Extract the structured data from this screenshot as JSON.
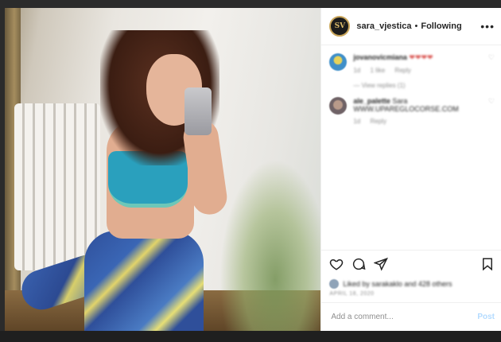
{
  "post": {
    "username": "sara_vjestica",
    "avatar_initials": "SV",
    "separator": "•",
    "follow_status": "Following",
    "more_icon": "more-horizontal-icon"
  },
  "comments": [
    {
      "name": "jovanovicmiana",
      "text": "❤❤❤❤",
      "meta": [
        "1d",
        "1 like",
        "Reply"
      ],
      "replies_label": "View replies (1)",
      "avatar_color": "#3f8fc9"
    },
    {
      "name": "ale_palette",
      "text": "Sara WWW.UPAREGLOCORSE.COM",
      "meta": [
        "1d",
        "Reply"
      ],
      "avatar_color": "#7a6a6e"
    }
  ],
  "actions": {
    "like_icon": "heart-icon",
    "comment_icon": "comment-icon",
    "share_icon": "share-icon",
    "save_icon": "bookmark-icon"
  },
  "likes_text": "Liked by sarakaklo and 428 others",
  "date_text": "APRIL 18, 2020",
  "add_comment": {
    "placeholder": "Add a comment...",
    "post_label": "Post"
  }
}
